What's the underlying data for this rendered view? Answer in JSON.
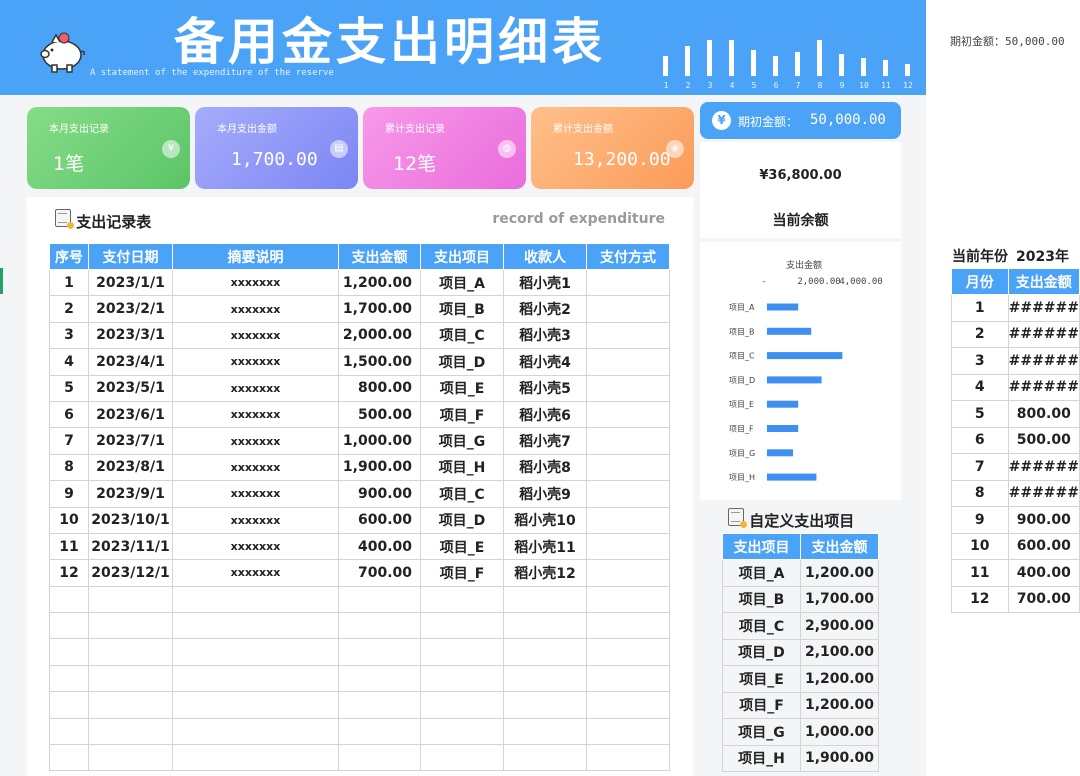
{
  "header": {
    "title": "备用金支出明细表",
    "subtitle": "A statement of the expenditure of the reserve",
    "months": [
      "1",
      "2",
      "3",
      "4",
      "5",
      "6",
      "7",
      "8",
      "9",
      "10",
      "11",
      "12"
    ],
    "initial_note": "期初金额：50,000.00"
  },
  "cards": [
    {
      "label": "本月支出记录",
      "value": "1笔",
      "icon": "coin-icon"
    },
    {
      "label": "本月支出金额",
      "value": "1,700.00",
      "icon": "wallet-icon"
    },
    {
      "label": "累计支出记录",
      "value": "12笔",
      "icon": "purse-icon"
    },
    {
      "label": "累计支出金额",
      "value": "13,200.00",
      "icon": "money-bag-icon"
    }
  ],
  "balance": {
    "initial_label": "期初金额：",
    "initial_value": "50,000.00",
    "current_value": "¥36,800.00",
    "current_label": "当前余额"
  },
  "expenditure": {
    "title": "支出记录表",
    "title_en": "record of expenditure",
    "columns": [
      "序号",
      "支付日期",
      "摘要说明",
      "支出金额",
      "支出项目",
      "收款人",
      "支付方式"
    ],
    "rows": [
      [
        "1",
        "2023/1/1",
        "xxxxxxx",
        "1,200.00",
        "项目_A",
        "稻小壳1",
        ""
      ],
      [
        "2",
        "2023/2/1",
        "xxxxxxx",
        "1,700.00",
        "项目_B",
        "稻小壳2",
        ""
      ],
      [
        "3",
        "2023/3/1",
        "xxxxxxx",
        "2,000.00",
        "项目_C",
        "稻小壳3",
        ""
      ],
      [
        "4",
        "2023/4/1",
        "xxxxxxx",
        "1,500.00",
        "项目_D",
        "稻小壳4",
        ""
      ],
      [
        "5",
        "2023/5/1",
        "xxxxxxx",
        "800.00",
        "项目_E",
        "稻小壳5",
        ""
      ],
      [
        "6",
        "2023/6/1",
        "xxxxxxx",
        "500.00",
        "项目_F",
        "稻小壳6",
        ""
      ],
      [
        "7",
        "2023/7/1",
        "xxxxxxx",
        "1,000.00",
        "项目_G",
        "稻小壳7",
        ""
      ],
      [
        "8",
        "2023/8/1",
        "xxxxxxx",
        "1,900.00",
        "项目_H",
        "稻小壳8",
        ""
      ],
      [
        "9",
        "2023/9/1",
        "xxxxxxx",
        "900.00",
        "项目_C",
        "稻小壳9",
        ""
      ],
      [
        "10",
        "2023/10/1",
        "xxxxxxx",
        "600.00",
        "项目_D",
        "稻小壳10",
        ""
      ],
      [
        "11",
        "2023/11/1",
        "xxxxxxx",
        "400.00",
        "项目_E",
        "稻小壳11",
        ""
      ],
      [
        "12",
        "2023/12/1",
        "xxxxxxx",
        "700.00",
        "项目_F",
        "稻小壳12",
        ""
      ]
    ],
    "empty_rows": 7
  },
  "chart_data": {
    "type": "bar",
    "orientation": "horizontal",
    "title": "支出金额",
    "categories": [
      "项目_A",
      "项目_B",
      "项目_C",
      "项目_D",
      "项目_E",
      "项目_F",
      "项目_G",
      "项目_H"
    ],
    "values": [
      1200,
      1700,
      2900,
      2100,
      1200,
      1200,
      1000,
      1900
    ],
    "xlim": [
      0,
      4000
    ],
    "tick_labels": [
      "-",
      "2,000.00",
      "4,000.00"
    ],
    "color": "#3d8ff0"
  },
  "custom_items": {
    "title": "自定义支出项目",
    "columns": [
      "支出项目",
      "支出金额"
    ],
    "rows": [
      [
        "项目_A",
        "1,200.00"
      ],
      [
        "项目_B",
        "1,700.00"
      ],
      [
        "项目_C",
        "2,900.00"
      ],
      [
        "项目_D",
        "2,100.00"
      ],
      [
        "项目_E",
        "1,200.00"
      ],
      [
        "项目_F",
        "1,200.00"
      ],
      [
        "项目_G",
        "1,000.00"
      ],
      [
        "项目_H",
        "1,900.00"
      ]
    ]
  },
  "monthly": {
    "year_label": "当前年份",
    "year": "2023年",
    "columns": [
      "月份",
      "支出金额"
    ],
    "rows": [
      [
        "1",
        "######"
      ],
      [
        "2",
        "######"
      ],
      [
        "3",
        "######"
      ],
      [
        "4",
        "######"
      ],
      [
        "5",
        "800.00"
      ],
      [
        "6",
        "500.00"
      ],
      [
        "7",
        "######"
      ],
      [
        "8",
        "######"
      ],
      [
        "9",
        "900.00"
      ],
      [
        "10",
        "600.00"
      ],
      [
        "11",
        "400.00"
      ],
      [
        "12",
        "700.00"
      ]
    ]
  },
  "colors": {
    "accent": "#4ba3f7",
    "bar": "#3d8ff0"
  }
}
